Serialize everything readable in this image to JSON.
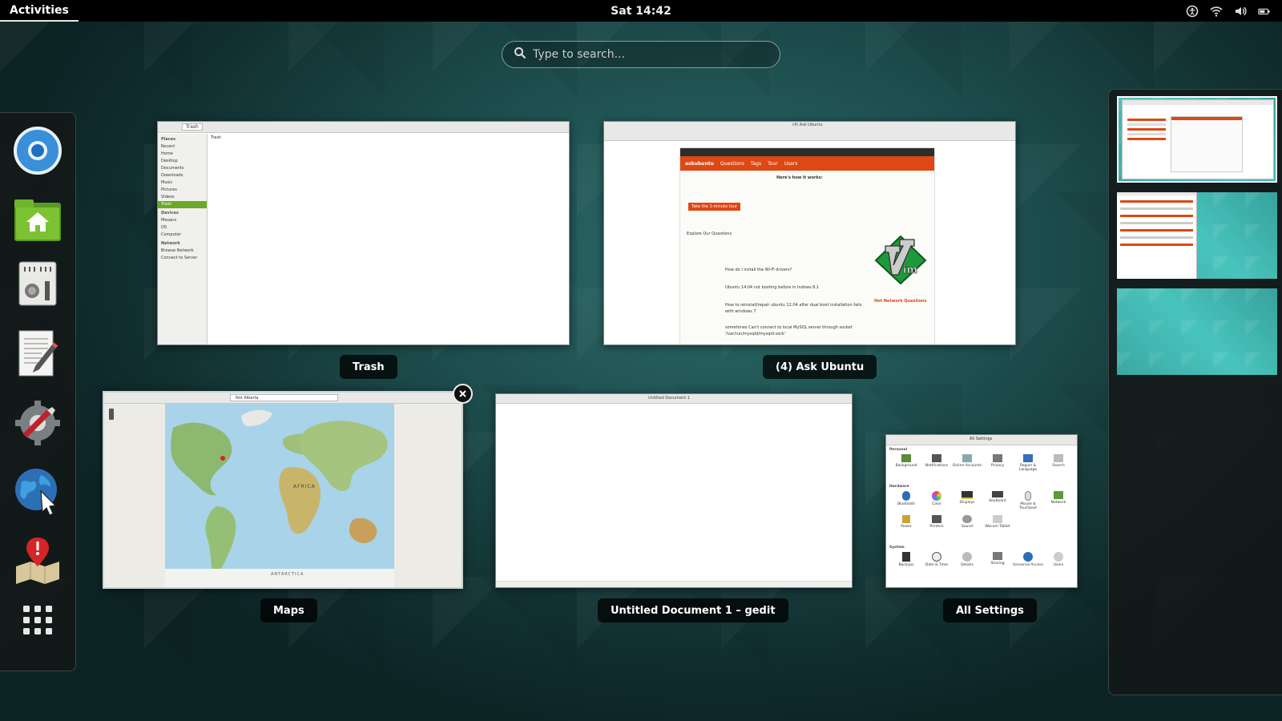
{
  "topbar": {
    "activities_label": "Activities",
    "clock": "Sat 14:42",
    "tray_icons": [
      "accessibility-icon",
      "wifi-icon",
      "volume-icon",
      "battery-icon"
    ]
  },
  "search": {
    "placeholder": "Type to search..."
  },
  "dash": {
    "apps": [
      "Chromium",
      "Files",
      "Mixer",
      "Text Editor",
      "Settings Tool",
      "Web Browser",
      "Maps"
    ],
    "show_apps": "show-apps-icon"
  },
  "windows": [
    {
      "id": "trash",
      "label": "Trash",
      "titlebar": "Trash"
    },
    {
      "id": "askubuntu",
      "label": "(4) Ask Ubuntu",
      "titlebar": "(4) Ask Ubuntu"
    },
    {
      "id": "maps",
      "label": "Maps",
      "titlebar": ""
    },
    {
      "id": "gedit",
      "label": "Untitled Document 1 – gedit",
      "titlebar": "Untitled Document 1"
    },
    {
      "id": "settings",
      "label": "All Settings",
      "titlebar": "All Settings"
    }
  ],
  "trash_sidebar": {
    "sections": [
      {
        "title": "Places",
        "items": [
          "Recent",
          "Home",
          "Desktop",
          "Documents",
          "Downloads",
          "Music",
          "Pictures",
          "Videos",
          "Trash"
        ]
      },
      {
        "title": "Devices",
        "items": [
          "Mesanx",
          "OS",
          "Computer"
        ]
      },
      {
        "title": "Network",
        "items": [
          "Browse Network",
          "Connect to Server"
        ]
      }
    ],
    "content_header": "Trash"
  },
  "askubuntu": {
    "brand": "askubuntu",
    "nav": [
      "Questions",
      "Tags",
      "Tour",
      "Users"
    ],
    "how_it_works": "Here's how it works:",
    "cta": "Take the 1-minute tour",
    "explore": "Explore Our Questions",
    "questions": [
      "How do I install the Wi-Fi drivers?",
      "Ubuntu 14.04 not booting before in Indows 8.1",
      "How to reinstall/repair ubuntu 12.04 after dual boot installation fails with windows 7",
      "sometimes Can't connect to local MySQL server through socket '/var/run/mysqld/mysqld.sock'"
    ],
    "hot": "Hot Network Questions"
  },
  "maps": {
    "search_value": "Not Alberta",
    "continents": [
      "AFRICA",
      "ANTARCTICA"
    ]
  },
  "settings_window": {
    "title": "All Settings",
    "sections": [
      {
        "title": "Personal",
        "items": [
          "Background",
          "Notifications",
          "Online Accounts",
          "Privacy",
          "Region & Language",
          "Search"
        ]
      },
      {
        "title": "Hardware",
        "items": [
          "Bluetooth",
          "Color",
          "Displays",
          "Keyboard",
          "Mouse & Touchpad",
          "Network",
          "Power",
          "Printers",
          "Sound",
          "Wacom Tablet"
        ]
      },
      {
        "title": "System",
        "items": [
          "Backups",
          "Date & Time",
          "Details",
          "Sharing",
          "Universal Access",
          "Users"
        ]
      }
    ]
  },
  "colors": {
    "topbar": "#000000",
    "ubuntu_orange": "#dd4814",
    "files_green": "#6aaa28",
    "workspace_teal": "#44b8b2"
  }
}
